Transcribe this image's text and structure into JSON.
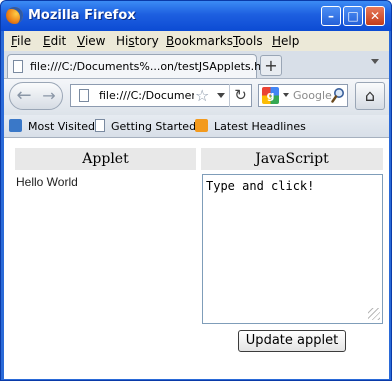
{
  "window": {
    "title": "Mozilla Firefox",
    "minimize_glyph": "–",
    "maximize_glyph": "□",
    "close_glyph": "✕"
  },
  "menu": {
    "items": [
      {
        "key": "F",
        "rest": "ile"
      },
      {
        "key": "E",
        "rest": "dit"
      },
      {
        "key": "V",
        "rest": "iew"
      },
      {
        "key": "",
        "pre": "Hi",
        "keymid": "s",
        "rest": "tory"
      },
      {
        "key": "B",
        "rest": "ookmarks"
      },
      {
        "key": "T",
        "rest": "ools"
      },
      {
        "key": "H",
        "rest": "elp"
      }
    ]
  },
  "tabs": {
    "active_label": "file:///C:/Documents%...on/testJSApplets.htm",
    "new_tab_glyph": "+"
  },
  "navbar": {
    "back_glyph": "←",
    "forward_glyph": "→",
    "url": "file:///C:/Documer",
    "star_glyph": "☆",
    "reload_glyph": "↻",
    "search_engine_letter": "g",
    "search_placeholder": "Google",
    "home_glyph": "⌂"
  },
  "bookmarks": {
    "items": [
      {
        "label": "Most Visited",
        "icon": "most-visited-icon"
      },
      {
        "label": "Getting Started",
        "icon": "page-icon"
      },
      {
        "label": "Latest Headlines",
        "icon": "rss-icon"
      }
    ]
  },
  "page": {
    "applet_header": "Applet",
    "js_header": "JavaScript",
    "applet_output": "Hello World",
    "textarea_value": "Type and click!",
    "update_button": "Update applet"
  },
  "colors": {
    "titlebar": "#1d5fe0",
    "chrome": "#ece9d8",
    "header_bg": "#e8e8e8",
    "textarea_border": "#7f9db9"
  }
}
